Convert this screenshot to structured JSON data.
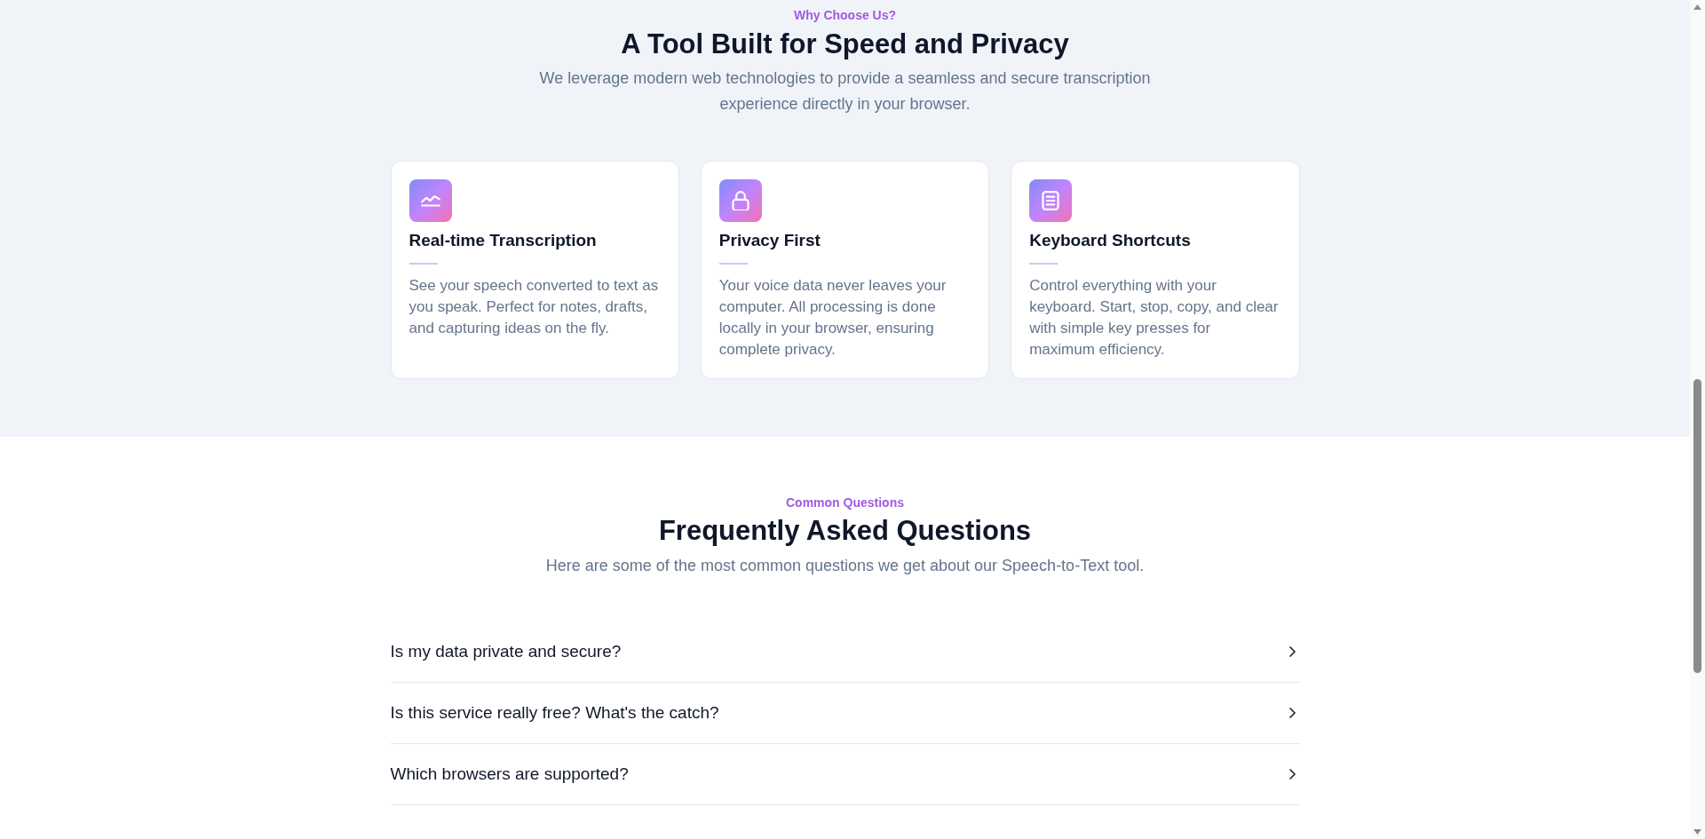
{
  "features_section": {
    "eyebrow": "Why Choose Us?",
    "title": "A Tool Built for Speed and Privacy",
    "subtitle": "We leverage modern web technologies to provide a seamless and secure transcription experience directly in your browser.",
    "cards": [
      {
        "kind": "chart",
        "title": "Real-time Transcription",
        "description": "See your speech converted to text as you speak. Perfect for notes, drafts, and capturing ideas on the fly."
      },
      {
        "kind": "lock",
        "title": "Privacy First",
        "description": "Your voice data never leaves your computer. All processing is done locally in your browser, ensuring complete privacy."
      },
      {
        "kind": "document",
        "title": "Keyboard Shortcuts",
        "description": "Control everything with your keyboard. Start, stop, copy, and clear with simple key presses for maximum efficiency."
      }
    ]
  },
  "faq_section": {
    "eyebrow": "Common Questions",
    "title": "Frequently Asked Questions",
    "subtitle": "Here are some of the most common questions we get about our Speech-to-Text tool.",
    "questions": [
      {
        "question": "Is my data private and secure?",
        "expanded": false
      },
      {
        "question": "Is this service really free? What's the catch?",
        "expanded": false
      },
      {
        "question": "Which browsers are supported?",
        "expanded": false
      }
    ]
  }
}
